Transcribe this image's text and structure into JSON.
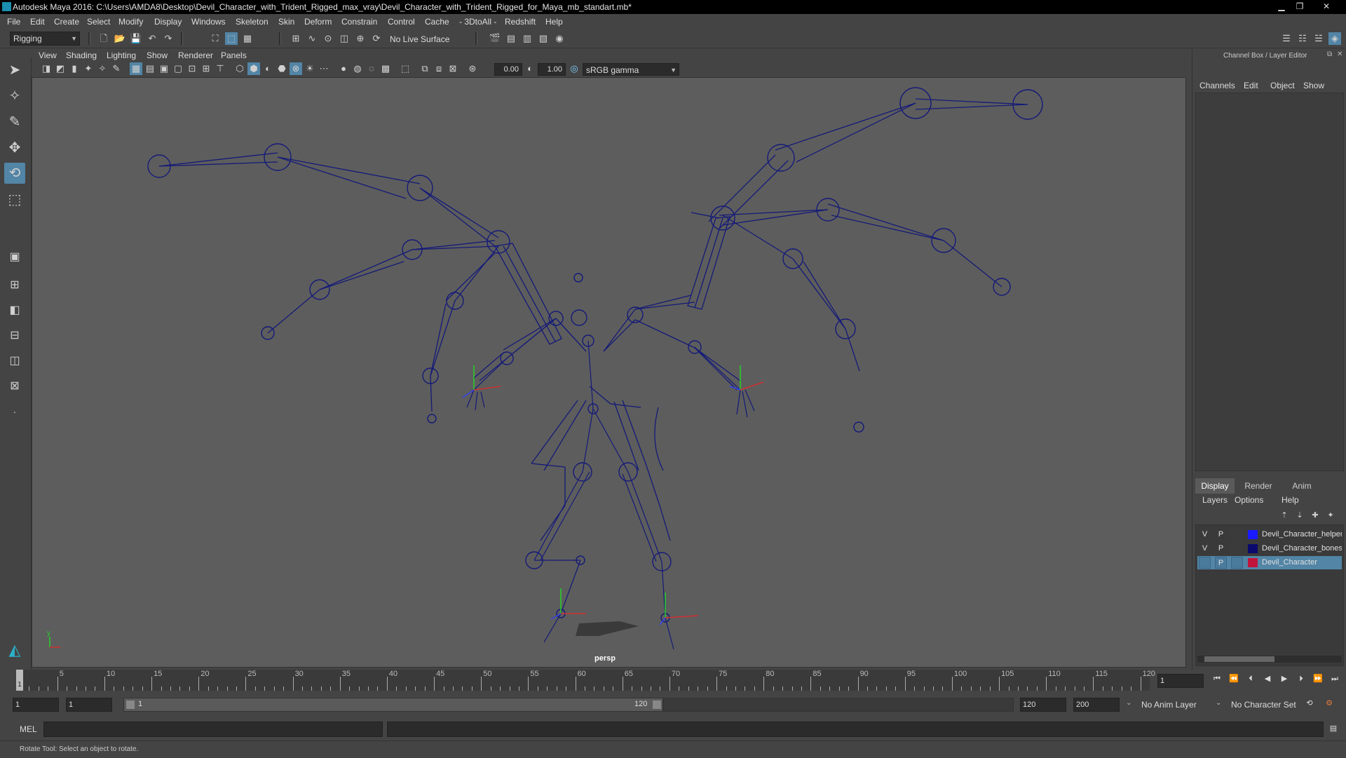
{
  "window": {
    "title": "Autodesk Maya 2016: C:\\Users\\AMDA8\\Desktop\\Devil_Character_with_Trident_Rigged_max_vray\\Devil_Character_with_Trident_Rigged_for_Maya_mb_standart.mb*",
    "minimize": "▁",
    "maximize": "❐",
    "close": "✕"
  },
  "menubar": [
    "File",
    "Edit",
    "Create",
    "Select",
    "Modify",
    "Display",
    "Windows",
    "Skeleton",
    "Skin",
    "Deform",
    "Constrain",
    "Control",
    "Cache",
    "- 3DtoAll -",
    "Redshift",
    "Help"
  ],
  "shelf": {
    "menu_set": "Rigging",
    "live_surface": "No Live Surface"
  },
  "viewport": {
    "menu": [
      "View",
      "Shading",
      "Lighting",
      "Show",
      "Renderer",
      "Panels"
    ],
    "exposure": "0.00",
    "gamma": "1.00",
    "color_space": "sRGB gamma",
    "camera": "persp",
    "axis_y": "y"
  },
  "channel_box": {
    "title": "Channel Box / Layer Editor",
    "menu": [
      "Channels",
      "Edit",
      "Object",
      "Show"
    ]
  },
  "layer_editor": {
    "tabs": [
      "Display",
      "Render",
      "Anim"
    ],
    "active_tab": "Display",
    "menu": [
      "Layers",
      "Options",
      "Help"
    ],
    "layers": [
      {
        "v": "V",
        "p": "P",
        "name": "Devil_Character_helpers",
        "color": "#1a1aff",
        "selected": false
      },
      {
        "v": "V",
        "p": "P",
        "name": "Devil_Character_bones",
        "color": "#0a0a6e",
        "selected": false
      },
      {
        "v": "",
        "p": "P",
        "name": "Devil_Character",
        "color": "#c0143c",
        "selected": true
      }
    ]
  },
  "timeline": {
    "labels": [
      "5",
      "10",
      "15",
      "20",
      "25",
      "30",
      "35",
      "40",
      "45",
      "50",
      "55",
      "60",
      "65",
      "70",
      "75",
      "80",
      "85",
      "90",
      "95",
      "100",
      "105",
      "110",
      "115",
      "120"
    ],
    "current_marker": "1",
    "current_frame": "1"
  },
  "range": {
    "start": "1",
    "playback_start": "1",
    "slider_start": "1",
    "slider_end": "120",
    "playback_end": "120",
    "end": "200",
    "anim_layer": "No Anim Layer",
    "character_set": "No Character Set"
  },
  "command_line": {
    "language": "MEL"
  },
  "help_line": {
    "text": "Rotate Tool: Select an object to rotate."
  }
}
